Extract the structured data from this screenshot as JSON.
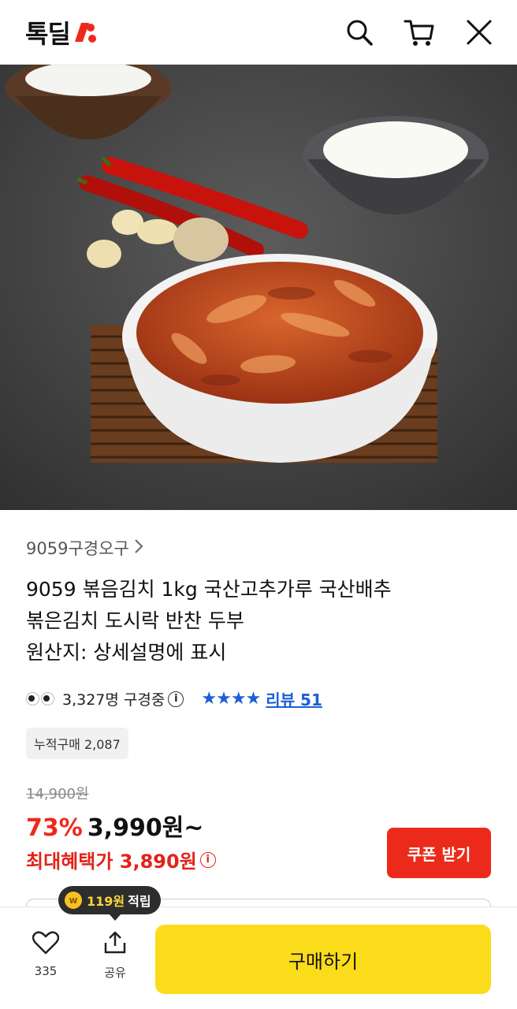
{
  "header": {
    "logo_text": "톡딜",
    "logo_accent": "#f0281c",
    "icons": [
      "search-icon",
      "cart-icon",
      "close-icon"
    ]
  },
  "product": {
    "image_alt": "볶음김치 상품 이미지",
    "seller": "9059구경오구",
    "title_lines": [
      "9059 볶음김치 1kg 국산고추가루 국산배추",
      "볶은김치 도시락 반찬 두부",
      "원산지: 상세설명에 표시"
    ],
    "viewers": "3,327명 구경중",
    "rating_stars": 4,
    "review_label": "리뷰 51",
    "cumulative_badge": "누적구매 2,087",
    "original_price": "14,900원",
    "discount": "73%",
    "price": "3,990원~",
    "max_benefit": "최대혜택가 3,890원"
  },
  "coupon_button": "쿠폰 받기",
  "points_bubble": {
    "amount": "119원",
    "label": "적립"
  },
  "bottom_bar": {
    "like_count": "335",
    "share_label": "공유",
    "buy_label": "구매하기",
    "buy_color": "#fbdc1a"
  }
}
